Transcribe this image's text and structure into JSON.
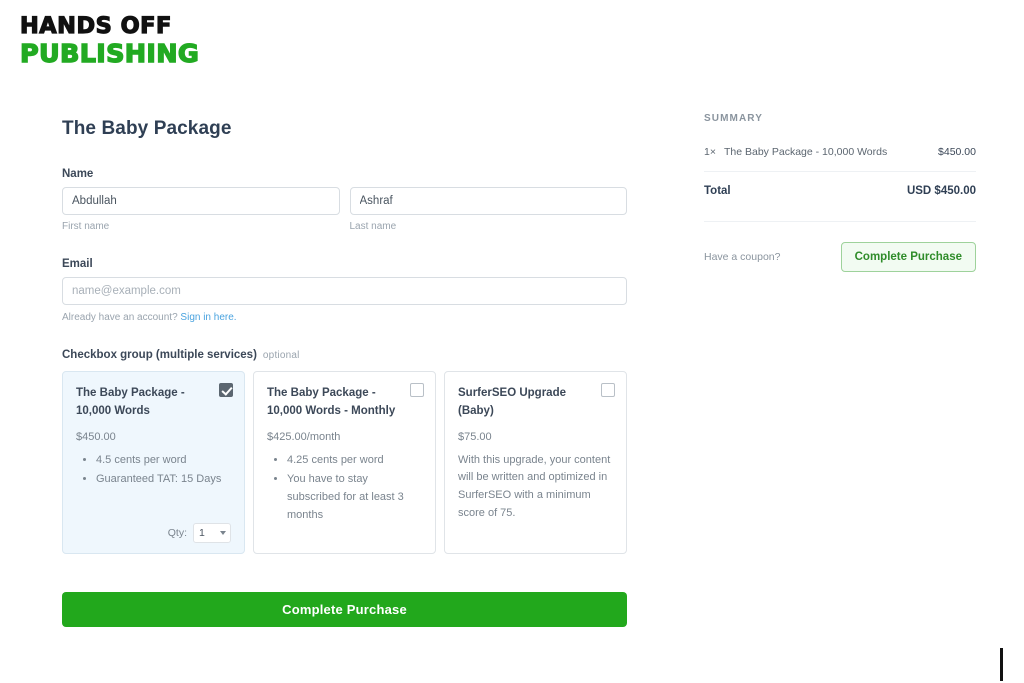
{
  "brand": {
    "logo_line1": "HANDS OFF",
    "logo_line2": "PUBLISHING",
    "logo_black": "#111111",
    "logo_green": "#22aa22"
  },
  "form": {
    "title": "The Baby Package",
    "name": {
      "label": "Name",
      "first_value": "Abdullah",
      "first_placeholder": "First name",
      "first_helper": "First name",
      "last_value": "Ashraf",
      "last_placeholder": "Last name",
      "last_helper": "Last name"
    },
    "email": {
      "label": "Email",
      "value": "",
      "placeholder": "name@example.com",
      "note_prefix": "Already have an account?",
      "note_link": "Sign in here."
    },
    "checkbox_group": {
      "label": "Checkbox group (multiple services)",
      "optional_tag": "optional",
      "cards": [
        {
          "title": "The Baby Package - 10,000 Words",
          "price": "$450.00",
          "bullets": [
            "4.5 cents per word",
            "Guaranteed TAT: 15 Days"
          ],
          "description": "",
          "selected": true,
          "qty_label": "Qty:",
          "qty_value": "1"
        },
        {
          "title": "The Baby Package - 10,000 Words - Monthly",
          "price": "$425.00/month",
          "bullets": [
            "4.25 cents per word",
            "You have to stay subscribed for at least 3 months"
          ],
          "description": "",
          "selected": false
        },
        {
          "title": "SurferSEO Upgrade (Baby)",
          "price": "$75.00",
          "bullets": [],
          "description": "With this upgrade, your content will be written and optimized in SurferSEO with a minimum score of 75.",
          "selected": false
        }
      ]
    },
    "submit_label": "Complete Purchase",
    "submit_color": "#22a81c"
  },
  "summary": {
    "heading": "SUMMARY",
    "items": [
      {
        "qty": "1×",
        "name": "The Baby Package - 10,000 Words",
        "amount": "$450.00"
      }
    ],
    "total_label": "Total",
    "total_value": "USD $450.00",
    "coupon_label": "Have a coupon?",
    "submit_label": "Complete Purchase",
    "submit_accent": "#2f8c2a"
  }
}
